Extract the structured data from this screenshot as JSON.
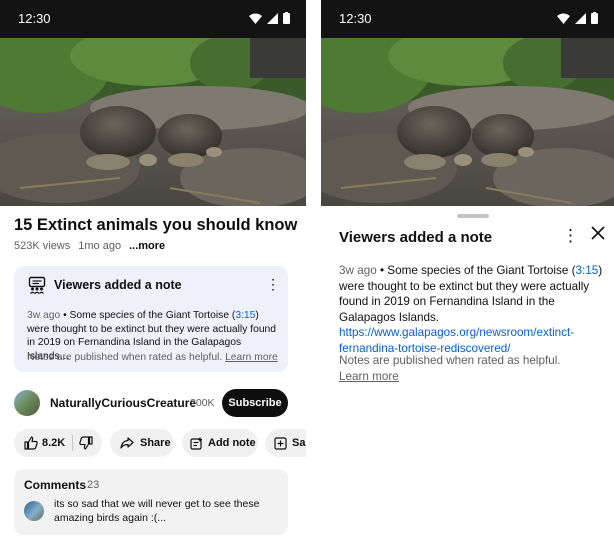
{
  "status_bar": {
    "time": "12:30"
  },
  "video": {
    "title": "15 Extinct animals you should know",
    "views": "523K views",
    "age": "1mo ago",
    "more_label": "...more"
  },
  "note_card": {
    "header": "Viewers added a note",
    "ago": "3w ago",
    "text_before": " • Some species of the Giant Tortoise (",
    "timestamp": "3:15",
    "text_after": ") were thought to be extinct but they were actually found in 2019 on Fernandina Island in the Galapagos Islands…",
    "footer_text": "Notes are published when rated as helpful. ",
    "footer_link": "Learn more"
  },
  "channel": {
    "name": "NaturallyCuriousCreature",
    "subscribers": "200K",
    "subscribe_label": "Subscribe"
  },
  "actions": {
    "like_count": "8.2K",
    "share_label": "Share",
    "add_note_label": "Add note",
    "save_label": "Sa"
  },
  "comments": {
    "title": "Comments",
    "count": "23",
    "first_comment": "its so sad that we will never get to see these amazing birds again :(..."
  },
  "note_sheet": {
    "title": "Viewers added a note",
    "ago": "3w ago",
    "text_before": " • Some species of the Giant Tortoise (",
    "timestamp": "3:15",
    "text_after": ") were thought to be extinct but they were actually found in 2019 on Fernandina Island in the Galapagos Islands. ",
    "url": "https://www.galapagos.org/newsroom/extinct-fernandina-tortoise-rediscovered/",
    "footer_text": "Notes are published when rated as helpful.",
    "footer_link": "Learn more"
  },
  "colors": {
    "accent_link": "#065fd4",
    "note_card_bg": "#eef1fb",
    "subscribe_bg": "#0f0f0f"
  }
}
